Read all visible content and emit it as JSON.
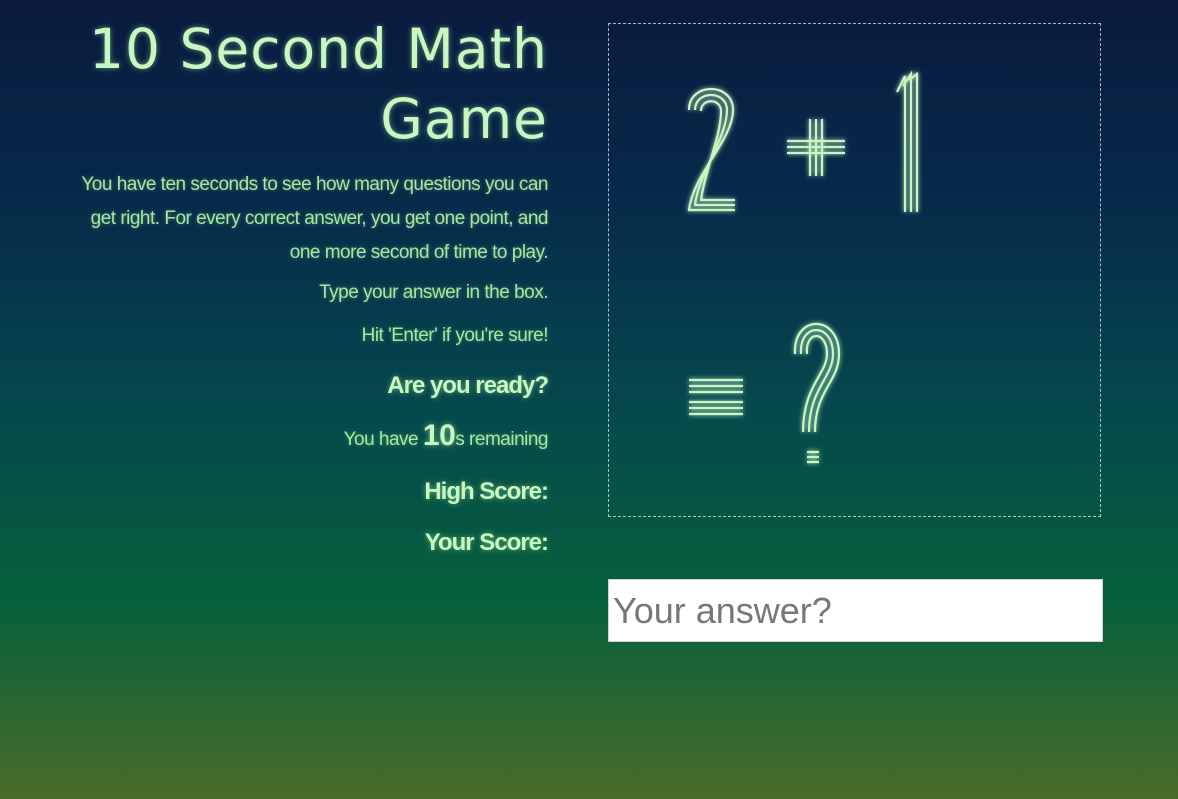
{
  "game": {
    "title_line1": "10 Second Math",
    "title_line2": "Game",
    "description": "You have ten seconds to see how many questions you can get right. For every correct answer, you get one point, and one more second of time to play.",
    "instruction_type": "Type your answer in the box.",
    "instruction_enter": "Hit 'Enter' if you're sure!",
    "ready_prompt": "Are you ready?",
    "timer_prefix": "You have ",
    "timer_value": "10",
    "timer_suffix": "s remaining",
    "high_score_label": "High Score:",
    "your_score_label": "Your Score:"
  },
  "question": {
    "operand1": "2",
    "operator": "+",
    "operand2": "1",
    "equals": "=",
    "unknown": "?"
  },
  "answer": {
    "placeholder": "Your answer?",
    "value": ""
  },
  "colors": {
    "text_glow": "#c8f7c2",
    "background_top": "#0a1a3e",
    "background_bottom": "#4a6b28"
  }
}
